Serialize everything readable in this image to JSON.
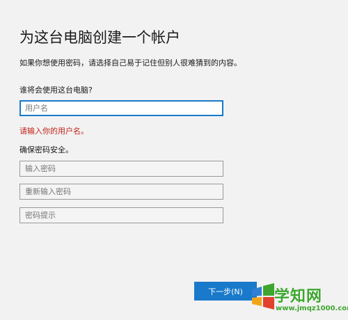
{
  "window": {
    "title": "为这台电脑创建一个帐户",
    "subtitle": "如果你想使用密码，请选择自己易于记住但别人很难猜到的内容。"
  },
  "user_section": {
    "label": "谁将会使用这台电脑?",
    "username_placeholder": "用户名",
    "username_value": "",
    "error": "请输入你的用户名。"
  },
  "password_section": {
    "label": "确保密码安全。",
    "password_placeholder": "输入密码",
    "confirm_placeholder": "重新输入密码",
    "hint_placeholder": "密码提示"
  },
  "footer": {
    "next_label": "下一步(N)"
  },
  "watermark": {
    "name": "学知网",
    "url": "www.jmqz1000.com"
  },
  "colors": {
    "background": "#f2f2f2",
    "accent": "#1979ca",
    "error": "#c0231a",
    "watermark": "#3da62e"
  },
  "icons": {
    "watermark_logo": "windows-logo-icon"
  }
}
